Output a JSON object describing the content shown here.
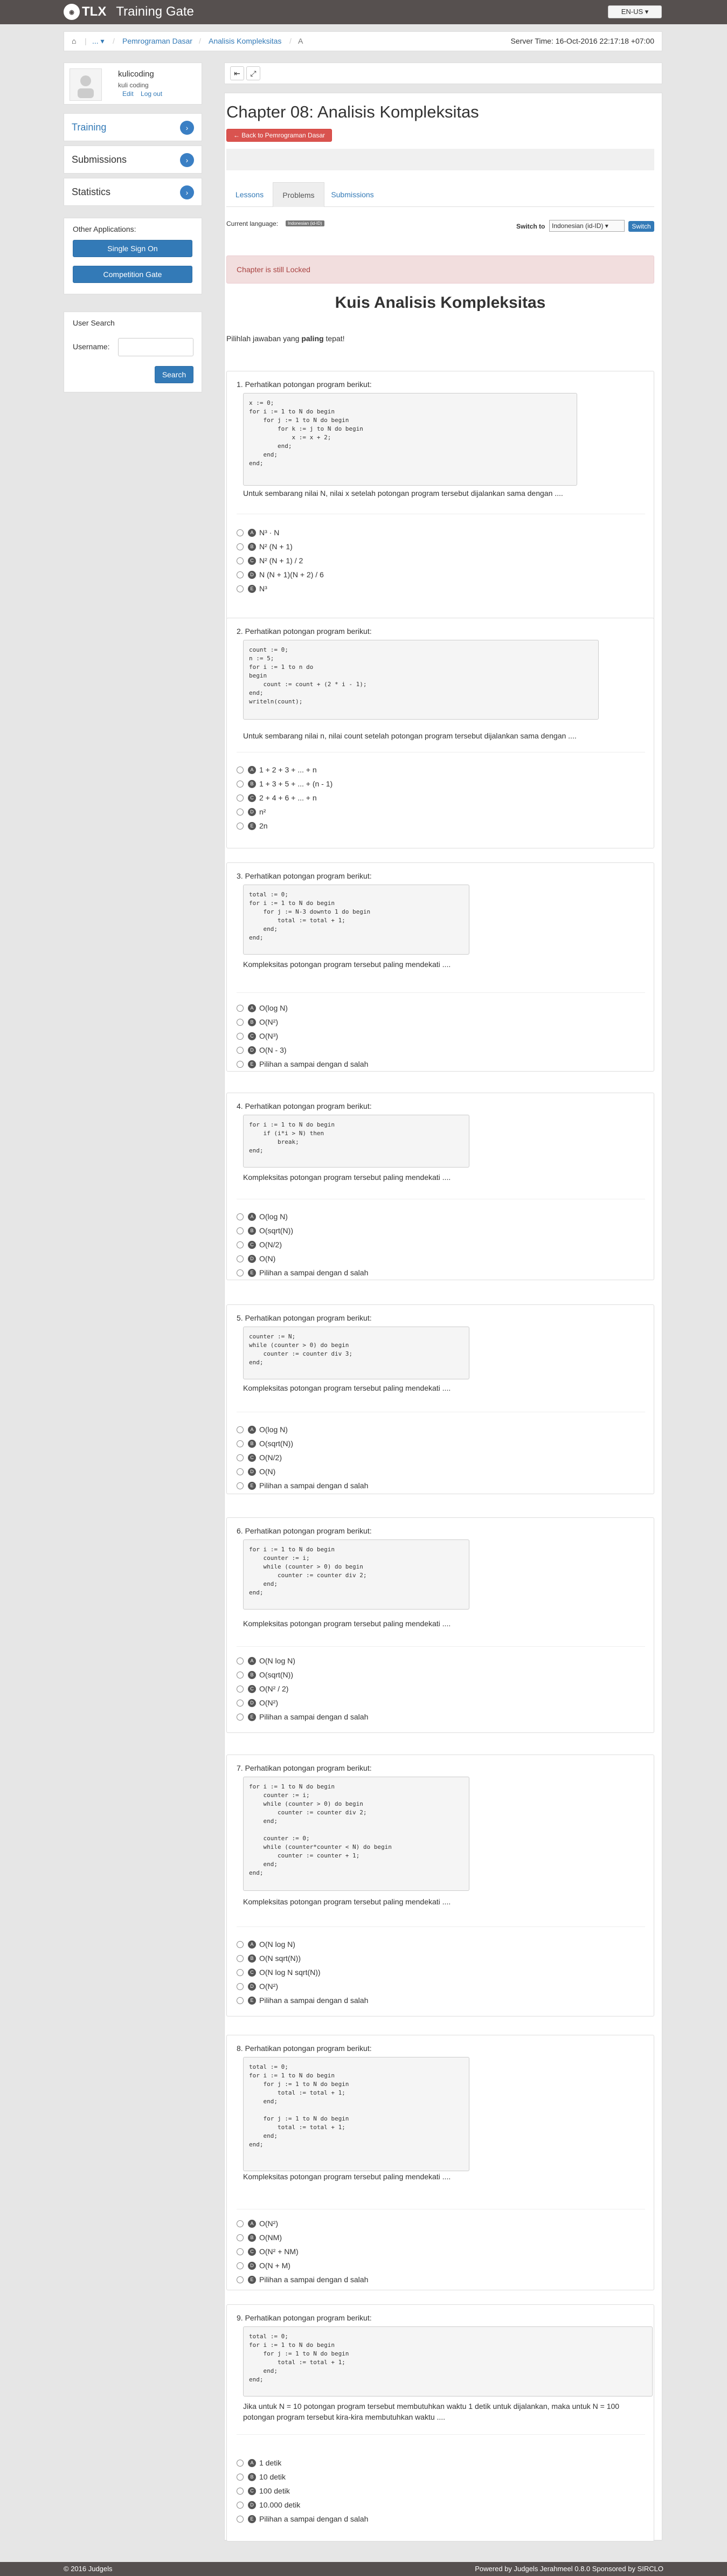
{
  "header": {
    "logo_text": "TLX",
    "app_title": "Training Gate",
    "lang_button": "EN-US ▾"
  },
  "breadcrumb": {
    "home_icon": "home-icon",
    "ellipsis": "... ▾",
    "item1": "Pemrograman Dasar",
    "item2": "Analisis Kompleksitas",
    "item3": "A",
    "server_time": "Server Time: 16-Oct-2016 22:17:18 +07:00"
  },
  "profile": {
    "username": "kulicoding",
    "realname": "kuli coding",
    "edit": "Edit",
    "logout": "Log out"
  },
  "sidebar": {
    "training": "Training",
    "submissions": "Submissions",
    "statistics": "Statistics"
  },
  "apps": {
    "title": "Other Applications:",
    "sso": "Single Sign On",
    "competition": "Competition Gate"
  },
  "user_search": {
    "title": "User Search",
    "label": "Username:",
    "button": "Search"
  },
  "main": {
    "chapter_title": "Chapter 08: Analisis Kompleksitas",
    "back_button": "← Back to Pemrograman Dasar",
    "tabs": [
      "Lessons",
      "Problems",
      "Submissions"
    ],
    "current_language_label": "Current language:",
    "current_language": "Indonesian (id-ID)",
    "switch_label": "Switch to",
    "switch_value": "Indonesian (id-ID) ▾",
    "switch_button": "Switch",
    "locked_message": "Chapter is still Locked",
    "quiz_title": "Kuis Analisis Kompleksitas",
    "instruction_pre": "Pilihlah jawaban yang ",
    "instruction_bold": "paling",
    "instruction_post": " tepat!"
  },
  "questions": [
    {
      "num": "1. Perhatikan potongan program berikut:",
      "code": "x := 0;\nfor i := 1 to N do begin\n    for j := 1 to N do begin\n        for k := j to N do begin\n            x := x + 2;\n        end;\n    end;\nend;",
      "text": "Untuk sembarang nilai N, nilai x setelah potongan program tersebut dijalankan sama dengan ....",
      "options": [
        [
          "A",
          "N³ · N"
        ],
        [
          "B",
          "N² (N + 1)"
        ],
        [
          "C",
          "N² (N + 1) / 2"
        ],
        [
          "D",
          "N (N + 1)(N + 2) / 6"
        ],
        [
          "E",
          "N³"
        ]
      ]
    },
    {
      "num": "2. Perhatikan potongan program berikut:",
      "code": "count := 0;\nn := 5;\nfor i := 1 to n do\nbegin\n    count := count + (2 * i - 1);\nend;\nwriteln(count);",
      "text": "Untuk sembarang nilai n, nilai count setelah potongan program tersebut dijalankan sama dengan ....",
      "options": [
        [
          "A",
          "1 + 2 + 3 + ... + n"
        ],
        [
          "B",
          "1 + 3 + 5 + ... + (n - 1)"
        ],
        [
          "C",
          "2 + 4 + 6 + ... + n"
        ],
        [
          "D",
          "n²"
        ],
        [
          "E",
          "2n"
        ]
      ]
    },
    {
      "num": "3. Perhatikan potongan program berikut:",
      "code": "total := 0;\nfor i := 1 to N do begin\n    for j := N-3 downto 1 do begin\n        total := total + 1;\n    end;\nend;",
      "text": "Kompleksitas potongan program tersebut paling mendekati ....",
      "options": [
        [
          "A",
          "O(log N)"
        ],
        [
          "B",
          "O(N²)"
        ],
        [
          "C",
          "O(N³)"
        ],
        [
          "D",
          "O(N - 3)"
        ],
        [
          "E",
          "Pilihan a sampai dengan d salah"
        ]
      ]
    },
    {
      "num": "4. Perhatikan potongan program berikut:",
      "code": "for i := 1 to N do begin\n    if (i*i > N) then\n        break;\nend;",
      "text": "Kompleksitas potongan program tersebut paling mendekati ....",
      "options": [
        [
          "A",
          "O(log N)"
        ],
        [
          "B",
          "O(sqrt(N))"
        ],
        [
          "C",
          "O(N/2)"
        ],
        [
          "D",
          "O(N)"
        ],
        [
          "E",
          "Pilihan a sampai dengan d salah"
        ]
      ]
    },
    {
      "num": "5. Perhatikan potongan program berikut:",
      "code": "counter := N;\nwhile (counter > 0) do begin\n    counter := counter div 3;\nend;",
      "text": "Kompleksitas potongan program tersebut paling mendekati ....",
      "options": [
        [
          "A",
          "O(log N)"
        ],
        [
          "B",
          "O(sqrt(N))"
        ],
        [
          "C",
          "O(N/2)"
        ],
        [
          "D",
          "O(N)"
        ],
        [
          "E",
          "Pilihan a sampai dengan d salah"
        ]
      ]
    },
    {
      "num": "6. Perhatikan potongan program berikut:",
      "code": "for i := 1 to N do begin\n    counter := i;\n    while (counter > 0) do begin\n        counter := counter div 2;\n    end;\nend;",
      "text": "Kompleksitas potongan program tersebut paling mendekati ....",
      "options": [
        [
          "A",
          "O(N log N)"
        ],
        [
          "B",
          "O(sqrt(N))"
        ],
        [
          "C",
          "O(N² / 2)"
        ],
        [
          "D",
          "O(N²)"
        ],
        [
          "E",
          "Pilihan a sampai dengan d salah"
        ]
      ]
    },
    {
      "num": "7. Perhatikan potongan program berikut:",
      "code": "for i := 1 to N do begin\n    counter := i;\n    while (counter > 0) do begin\n        counter := counter div 2;\n    end;\n\n    counter := 0;\n    while (counter*counter < N) do begin\n        counter := counter + 1;\n    end;\nend;",
      "text": "Kompleksitas potongan program tersebut paling mendekati ....",
      "options": [
        [
          "A",
          "O(N log N)"
        ],
        [
          "B",
          "O(N sqrt(N))"
        ],
        [
          "C",
          "O(N log N sqrt(N))"
        ],
        [
          "D",
          "O(N²)"
        ],
        [
          "E",
          "Pilihan a sampai dengan d salah"
        ]
      ]
    },
    {
      "num": "8. Perhatikan potongan program berikut:",
      "code": "total := 0;\nfor i := 1 to N do begin\n    for j := 1 to N do begin\n        total := total + 1;\n    end;\n\n    for j := 1 to N do begin\n        total := total + 1;\n    end;\nend;",
      "text": "Kompleksitas potongan program tersebut paling mendekati ....",
      "options": [
        [
          "A",
          "O(N²)"
        ],
        [
          "B",
          "O(NM)"
        ],
        [
          "C",
          "O(N² + NM)"
        ],
        [
          "D",
          "O(N + M)"
        ],
        [
          "E",
          "Pilihan a sampai dengan d salah"
        ]
      ]
    },
    {
      "num": "9. Perhatikan potongan program berikut:",
      "code": "total := 0;\nfor i := 1 to N do begin\n    for j := 1 to N do begin\n        total := total + 1;\n    end;\nend;",
      "text": "Jika untuk N = 10 potongan program tersebut membutuhkan waktu 1 detik untuk dijalankan, maka untuk N = 100 potongan program tersebut kira-kira membutuhkan waktu ....",
      "options": [
        [
          "A",
          "1 detik"
        ],
        [
          "B",
          "10 detik"
        ],
        [
          "C",
          "100 detik"
        ],
        [
          "D",
          "10.000 detik"
        ],
        [
          "E",
          "Pilihan a sampai dengan d salah"
        ]
      ]
    }
  ],
  "footer": {
    "left": "© 2016 Judgels",
    "right": "Powered by Judgels Jerahmeel 0.8.0 Sponsored by SIRCLO"
  }
}
